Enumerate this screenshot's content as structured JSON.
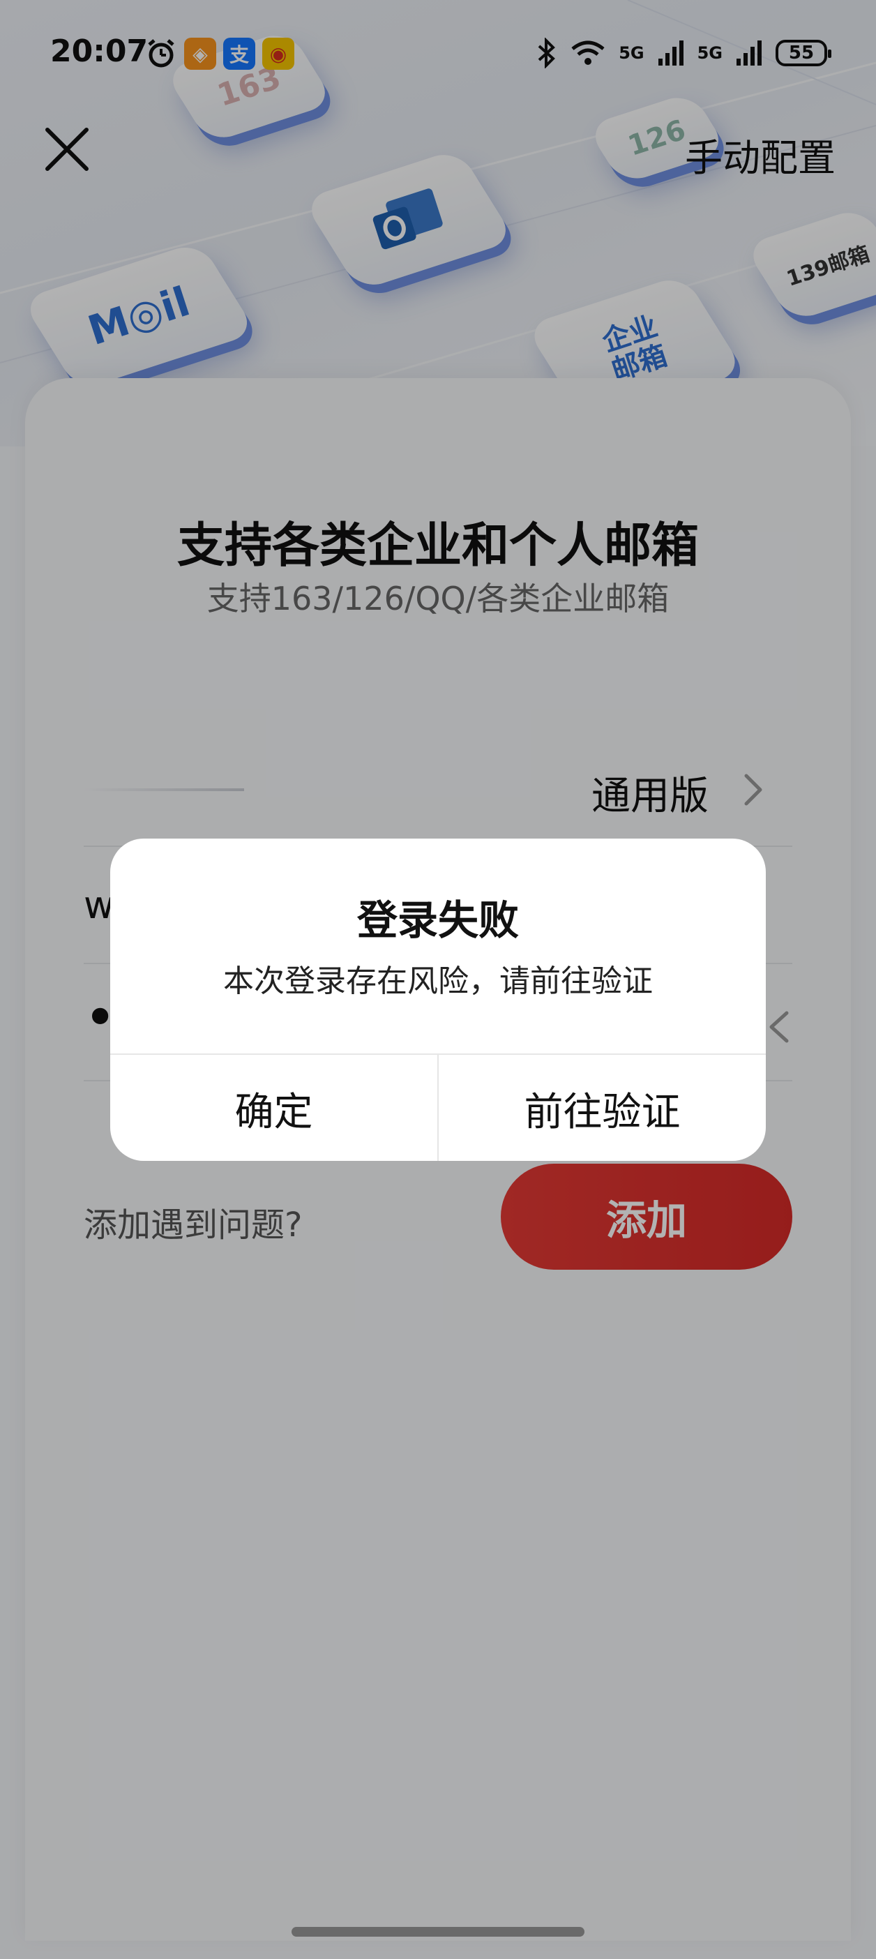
{
  "status_bar": {
    "time": "20:07",
    "network_1": "5G",
    "network_2": "5G",
    "battery": "55"
  },
  "nav": {
    "manual_config_label": "手动配置"
  },
  "hero_tiles": {
    "mail_text": "M◎il",
    "code_126": "126",
    "code_139": "139邮箱",
    "enterprise": "企业邮箱",
    "code_163": "163"
  },
  "card": {
    "title": "支持各类企业和个人邮箱",
    "subtitle": "支持163/126/QQ/各类企业邮箱",
    "version_label": "通用版",
    "account_value": "w",
    "password_value": "••",
    "help_link": "添加遇到问题?",
    "add_button": "添加"
  },
  "dialog": {
    "title": "登录失败",
    "message": "本次登录存在风险，请前往验证",
    "confirm_label": "确定",
    "verify_label": "前往验证"
  },
  "colors": {
    "accent": "#e53a35",
    "tile_blue": "#6f8fe0"
  }
}
